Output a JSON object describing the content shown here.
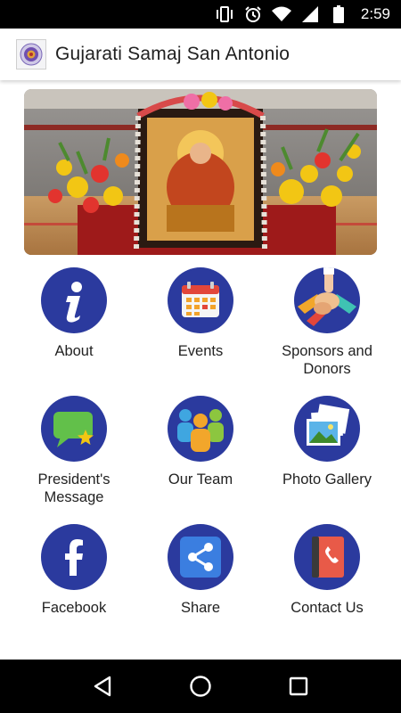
{
  "status_bar": {
    "time": "2:59",
    "icons": [
      "vibrate-icon",
      "alarm-icon",
      "wifi-icon",
      "signal-icon",
      "battery-icon"
    ]
  },
  "app_bar": {
    "title": "Gujarati Samaj San Antonio",
    "logo_icon": "samaj-logo-icon"
  },
  "banner": {
    "description_icon": "goddess-shrine-flowers-image"
  },
  "colors": {
    "circle_blue": "#2b3a9e",
    "text": "#222222",
    "status_bar": "#000000"
  },
  "menu": {
    "items": [
      {
        "label": "About",
        "icon": "info-icon"
      },
      {
        "label": "Events",
        "icon": "calendar-icon"
      },
      {
        "label": "Sponsors and\nDonors",
        "icon": "hands-icon"
      },
      {
        "label": "President's\nMessage",
        "icon": "chat-bubble-icon"
      },
      {
        "label": "Our Team",
        "icon": "team-icon"
      },
      {
        "label": "Photo Gallery",
        "icon": "photos-icon"
      },
      {
        "label": "Facebook",
        "icon": "facebook-icon"
      },
      {
        "label": "Share",
        "icon": "share-icon"
      },
      {
        "label": "Contact Us",
        "icon": "phone-book-icon"
      }
    ]
  },
  "nav_bar": {
    "buttons": [
      "back-icon",
      "home-icon",
      "recents-icon"
    ]
  }
}
